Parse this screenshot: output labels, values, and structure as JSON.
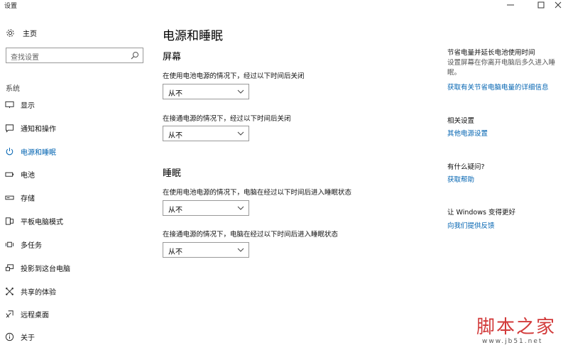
{
  "window": {
    "title": "设置",
    "minimize": "—",
    "maximize": "□",
    "close": "✕"
  },
  "sidebar": {
    "home_label": "主页",
    "search_placeholder": "查找设置",
    "section_label": "系统",
    "items": [
      {
        "label": "显示",
        "icon": "display-icon"
      },
      {
        "label": "通知和操作",
        "icon": "notification-icon"
      },
      {
        "label": "电源和睡眠",
        "icon": "power-icon",
        "active": true
      },
      {
        "label": "电池",
        "icon": "battery-icon"
      },
      {
        "label": "存储",
        "icon": "storage-icon"
      },
      {
        "label": "平板电脑模式",
        "icon": "tablet-mode-icon"
      },
      {
        "label": "多任务",
        "icon": "multitasking-icon"
      },
      {
        "label": "投影到这台电脑",
        "icon": "projection-icon"
      },
      {
        "label": "共享的体验",
        "icon": "shared-experiences-icon"
      },
      {
        "label": "远程桌面",
        "icon": "remote-desktop-icon"
      },
      {
        "label": "关于",
        "icon": "about-icon"
      }
    ]
  },
  "main": {
    "title": "电源和睡眠",
    "screen": {
      "heading": "屏幕",
      "battery_label": "在使用电池电源的情况下，经过以下时间后关闭",
      "battery_value": "从不",
      "plugged_label": "在接通电源的情况下，经过以下时间后关闭",
      "plugged_value": "从不"
    },
    "sleep": {
      "heading": "睡眠",
      "battery_label": "在使用电池电源的情况下，电脑在经过以下时间后进入睡眠状态",
      "battery_value": "从不",
      "plugged_label": "在接通电源的情况下，电脑在经过以下时间后进入睡眠状态",
      "plugged_value": "从不"
    }
  },
  "aside": {
    "tip_heading": "节省电量并延长电池使用时间",
    "tip_text": "设置屏幕在你离开电脑后多久进入睡眠。",
    "tip_link": "获取有关节省电脑电量的详细信息",
    "related_heading": "相关设置",
    "related_link": "其他电源设置",
    "help_heading": "有什么疑问?",
    "help_link": "获取帮助",
    "feedback_heading": "让 Windows 变得更好",
    "feedback_link": "向我们提供反馈"
  },
  "watermark": {
    "main": "脚本之家",
    "url": "www.jb51.net"
  },
  "colors": {
    "accent": "#0063b1",
    "watermark": "#d23a3a"
  }
}
